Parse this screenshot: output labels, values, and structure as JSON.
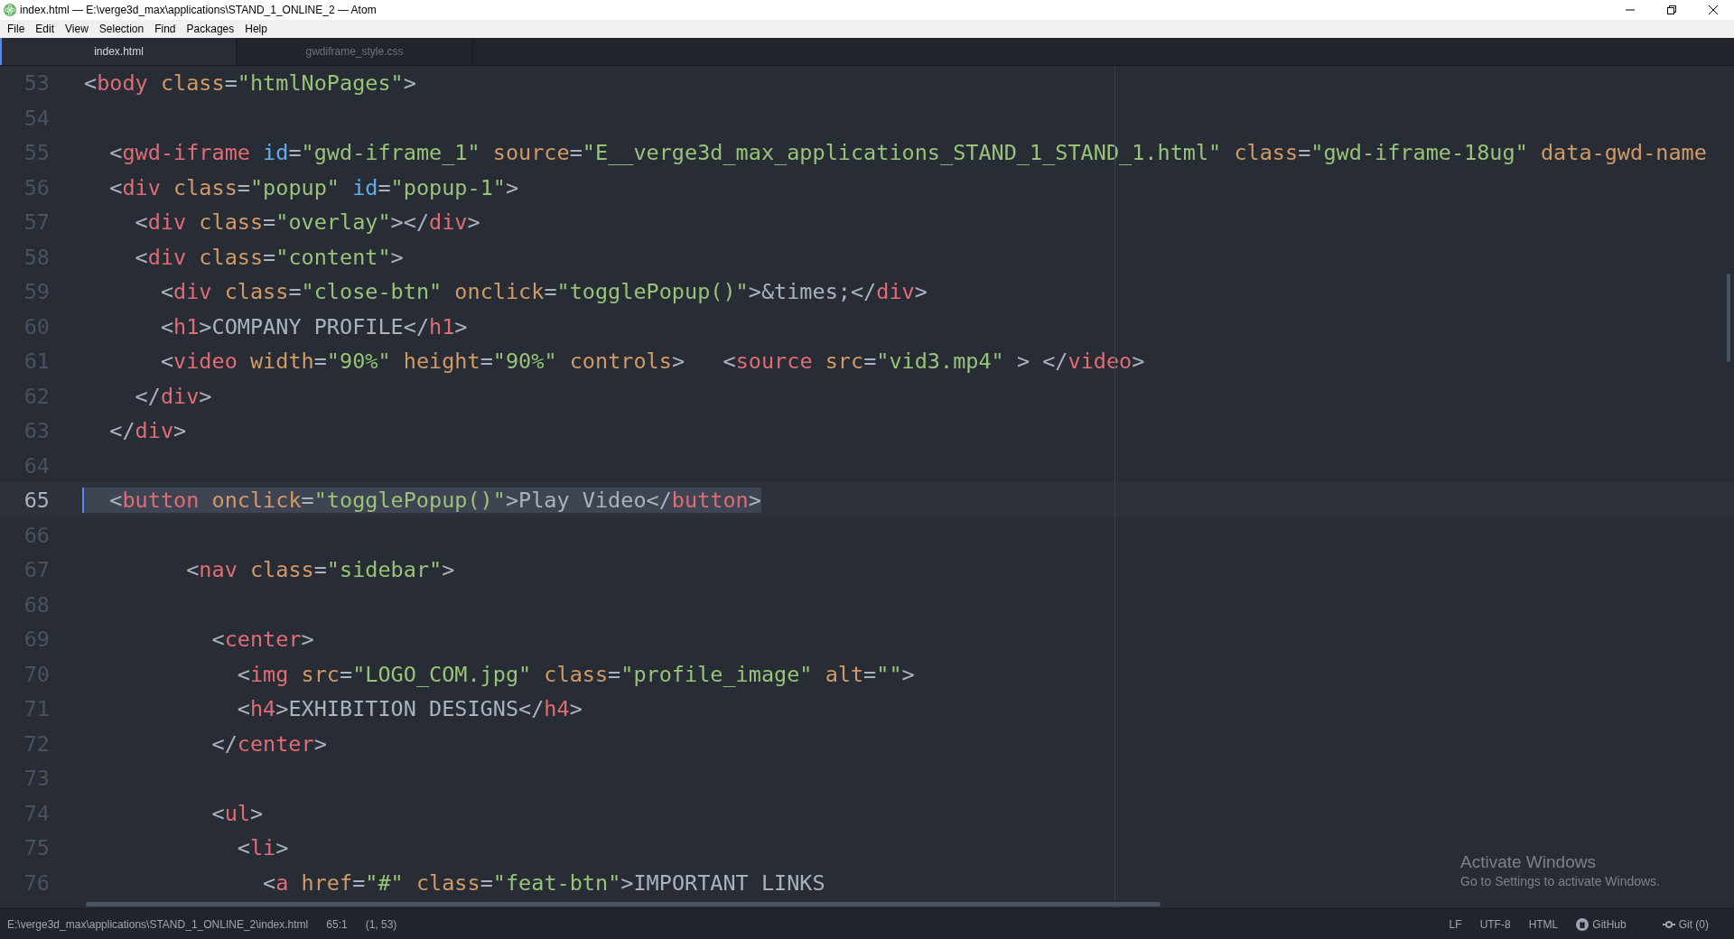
{
  "window": {
    "title": "index.html — E:\\verge3d_max\\applications\\STAND_1_ONLINE_2 — Atom"
  },
  "menu": [
    "File",
    "Edit",
    "View",
    "Selection",
    "Find",
    "Packages",
    "Help"
  ],
  "tabs": [
    {
      "label": "index.html",
      "selected": true
    },
    {
      "label": "gwdiframe_style.css",
      "selected": false
    }
  ],
  "editor": {
    "lines": [
      {
        "number": "53",
        "current": false,
        "tokens": [
          {
            "kind": "punct",
            "text": "<"
          },
          {
            "kind": "tag",
            "text": "body"
          },
          {
            "kind": "attr",
            "text": " class"
          },
          {
            "kind": "punct",
            "text": "="
          },
          {
            "kind": "string",
            "text": "\"htmlNoPages\""
          },
          {
            "kind": "punct",
            "text": ">"
          }
        ]
      },
      {
        "number": "54",
        "current": false
      },
      {
        "number": "55",
        "current": false,
        "tokens": [
          {
            "kind": "punct",
            "text": "  <"
          },
          {
            "kind": "tag",
            "text": "gwd-iframe"
          },
          {
            "kind": "id",
            "text": " id"
          },
          {
            "kind": "punct",
            "text": "="
          },
          {
            "kind": "string",
            "text": "\"gwd-iframe_1\""
          },
          {
            "kind": "attr",
            "text": " source"
          },
          {
            "kind": "punct",
            "text": "="
          },
          {
            "kind": "string",
            "text": "\"E__verge3d_max_applications_STAND_1_STAND_1.html\""
          },
          {
            "kind": "attr",
            "text": " class"
          },
          {
            "kind": "punct",
            "text": "="
          },
          {
            "kind": "string",
            "text": "\"gwd-iframe-18ug\""
          },
          {
            "kind": "attr",
            "text": " data-gwd-name"
          }
        ]
      },
      {
        "number": "56",
        "current": false,
        "tokens": [
          {
            "kind": "punct",
            "text": "  <"
          },
          {
            "kind": "tag",
            "text": "div"
          },
          {
            "kind": "attr",
            "text": " class"
          },
          {
            "kind": "punct",
            "text": "="
          },
          {
            "kind": "string",
            "text": "\"popup\""
          },
          {
            "kind": "id",
            "text": " id"
          },
          {
            "kind": "punct",
            "text": "="
          },
          {
            "kind": "string",
            "text": "\"popup-1\""
          },
          {
            "kind": "punct",
            "text": ">"
          }
        ]
      },
      {
        "number": "57",
        "current": false,
        "tokens": [
          {
            "kind": "punct",
            "text": "    <"
          },
          {
            "kind": "tag",
            "text": "div"
          },
          {
            "kind": "attr",
            "text": " class"
          },
          {
            "kind": "punct",
            "text": "="
          },
          {
            "kind": "string",
            "text": "\"overlay\""
          },
          {
            "kind": "punct",
            "text": "></"
          },
          {
            "kind": "tag",
            "text": "div"
          },
          {
            "kind": "punct",
            "text": ">"
          }
        ]
      },
      {
        "number": "58",
        "current": false,
        "tokens": [
          {
            "kind": "punct",
            "text": "    <"
          },
          {
            "kind": "tag",
            "text": "div"
          },
          {
            "kind": "attr",
            "text": " class"
          },
          {
            "kind": "punct",
            "text": "="
          },
          {
            "kind": "string",
            "text": "\"content\""
          },
          {
            "kind": "punct",
            "text": ">"
          }
        ]
      },
      {
        "number": "59",
        "current": false,
        "tokens": [
          {
            "kind": "punct",
            "text": "      <"
          },
          {
            "kind": "tag",
            "text": "div"
          },
          {
            "kind": "attr",
            "text": " class"
          },
          {
            "kind": "punct",
            "text": "="
          },
          {
            "kind": "string",
            "text": "\"close-btn\""
          },
          {
            "kind": "attr",
            "text": " onclick"
          },
          {
            "kind": "punct",
            "text": "="
          },
          {
            "kind": "string",
            "text": "\"togglePopup()\""
          },
          {
            "kind": "punct",
            "text": ">"
          },
          {
            "kind": "text",
            "text": "&times;"
          },
          {
            "kind": "punct",
            "text": "</"
          },
          {
            "kind": "tag",
            "text": "div"
          },
          {
            "kind": "punct",
            "text": ">"
          }
        ]
      },
      {
        "number": "60",
        "current": false,
        "tokens": [
          {
            "kind": "punct",
            "text": "      <"
          },
          {
            "kind": "tag",
            "text": "h1"
          },
          {
            "kind": "punct",
            "text": ">"
          },
          {
            "kind": "text",
            "text": "COMPANY PROFILE"
          },
          {
            "kind": "punct",
            "text": "</"
          },
          {
            "kind": "tag",
            "text": "h1"
          },
          {
            "kind": "punct",
            "text": ">"
          }
        ]
      },
      {
        "number": "61",
        "current": false,
        "tokens": [
          {
            "kind": "punct",
            "text": "      <"
          },
          {
            "kind": "tag",
            "text": "video"
          },
          {
            "kind": "attr",
            "text": " width"
          },
          {
            "kind": "punct",
            "text": "="
          },
          {
            "kind": "string",
            "text": "\"90%\""
          },
          {
            "kind": "attr",
            "text": " height"
          },
          {
            "kind": "punct",
            "text": "="
          },
          {
            "kind": "string",
            "text": "\"90%\""
          },
          {
            "kind": "attr",
            "text": " controls"
          },
          {
            "kind": "punct",
            "text": ">   <"
          },
          {
            "kind": "tag",
            "text": "source"
          },
          {
            "kind": "attr",
            "text": " src"
          },
          {
            "kind": "punct",
            "text": "="
          },
          {
            "kind": "string",
            "text": "\"vid3.mp4\""
          },
          {
            "kind": "punct",
            "text": " > </"
          },
          {
            "kind": "tag",
            "text": "video"
          },
          {
            "kind": "punct",
            "text": ">"
          }
        ]
      },
      {
        "number": "62",
        "current": false,
        "tokens": [
          {
            "kind": "punct",
            "text": "    </"
          },
          {
            "kind": "tag",
            "text": "div"
          },
          {
            "kind": "punct",
            "text": ">"
          }
        ]
      },
      {
        "number": "63",
        "current": false,
        "tokens": [
          {
            "kind": "punct",
            "text": "  </"
          },
          {
            "kind": "tag",
            "text": "div"
          },
          {
            "kind": "punct",
            "text": ">"
          }
        ]
      },
      {
        "number": "64",
        "current": false
      },
      {
        "number": "65",
        "current": true,
        "tokens": [
          {
            "kind": "punct",
            "text": "  <"
          },
          {
            "kind": "tag",
            "text": "button"
          },
          {
            "kind": "attr",
            "text": " onclick"
          },
          {
            "kind": "punct",
            "text": "="
          },
          {
            "kind": "string",
            "text": "\"togglePopup()\""
          },
          {
            "kind": "punct",
            "text": ">"
          },
          {
            "kind": "text",
            "text": "Play Video"
          },
          {
            "kind": "punct",
            "text": "</"
          },
          {
            "kind": "tag",
            "text": "button"
          },
          {
            "kind": "punct",
            "text": ">"
          }
        ]
      },
      {
        "number": "66",
        "current": false
      },
      {
        "number": "67",
        "current": false,
        "tokens": [
          {
            "kind": "punct",
            "text": "        <"
          },
          {
            "kind": "tag",
            "text": "nav"
          },
          {
            "kind": "attr",
            "text": " class"
          },
          {
            "kind": "punct",
            "text": "="
          },
          {
            "kind": "string",
            "text": "\"sidebar\""
          },
          {
            "kind": "punct",
            "text": ">"
          }
        ]
      },
      {
        "number": "68",
        "current": false
      },
      {
        "number": "69",
        "current": false,
        "tokens": [
          {
            "kind": "punct",
            "text": "          <"
          },
          {
            "kind": "tag",
            "text": "center"
          },
          {
            "kind": "punct",
            "text": ">"
          }
        ]
      },
      {
        "number": "70",
        "current": false,
        "tokens": [
          {
            "kind": "punct",
            "text": "            <"
          },
          {
            "kind": "tag",
            "text": "img"
          },
          {
            "kind": "attr",
            "text": " src"
          },
          {
            "kind": "punct",
            "text": "="
          },
          {
            "kind": "string",
            "text": "\"LOGO_COM.jpg\""
          },
          {
            "kind": "attr",
            "text": " class"
          },
          {
            "kind": "punct",
            "text": "="
          },
          {
            "kind": "string",
            "text": "\"profile_image\""
          },
          {
            "kind": "attr",
            "text": " alt"
          },
          {
            "kind": "punct",
            "text": "="
          },
          {
            "kind": "string",
            "text": "\"\""
          },
          {
            "kind": "punct",
            "text": ">"
          }
        ]
      },
      {
        "number": "71",
        "current": false,
        "tokens": [
          {
            "kind": "punct",
            "text": "            <"
          },
          {
            "kind": "tag",
            "text": "h4"
          },
          {
            "kind": "punct",
            "text": ">"
          },
          {
            "kind": "text",
            "text": "EXHIBITION DESIGNS"
          },
          {
            "kind": "punct",
            "text": "</"
          },
          {
            "kind": "tag",
            "text": "h4"
          },
          {
            "kind": "punct",
            "text": ">"
          }
        ]
      },
      {
        "number": "72",
        "current": false,
        "tokens": [
          {
            "kind": "punct",
            "text": "          </"
          },
          {
            "kind": "tag",
            "text": "center"
          },
          {
            "kind": "punct",
            "text": ">"
          }
        ]
      },
      {
        "number": "73",
        "current": false
      },
      {
        "number": "74",
        "current": false,
        "tokens": [
          {
            "kind": "punct",
            "text": "          <"
          },
          {
            "kind": "tag",
            "text": "ul"
          },
          {
            "kind": "punct",
            "text": ">"
          }
        ]
      },
      {
        "number": "75",
        "current": false,
        "tokens": [
          {
            "kind": "punct",
            "text": "            <"
          },
          {
            "kind": "tag",
            "text": "li"
          },
          {
            "kind": "punct",
            "text": ">"
          }
        ]
      },
      {
        "number": "76",
        "current": false,
        "tokens": [
          {
            "kind": "punct",
            "text": "              <"
          },
          {
            "kind": "tag",
            "text": "a"
          },
          {
            "kind": "attr",
            "text": " href"
          },
          {
            "kind": "punct",
            "text": "="
          },
          {
            "kind": "string",
            "text": "\"#\""
          },
          {
            "kind": "attr",
            "text": " class"
          },
          {
            "kind": "punct",
            "text": "="
          },
          {
            "kind": "string",
            "text": "\"feat-btn\""
          },
          {
            "kind": "punct",
            "text": ">"
          },
          {
            "kind": "text",
            "text": "IMPORTANT LINKS"
          }
        ]
      }
    ]
  },
  "activation_notice": {
    "title": "Activate Windows",
    "subtitle": "Go to Settings to activate Windows."
  },
  "status_bar": {
    "path": "E:\\verge3d_max\\applications\\STAND_1_ONLINE_2\\index.html",
    "cursor": "65:1",
    "selection": "(1, 53)",
    "line_ending": "LF",
    "encoding": "UTF-8",
    "grammar": "HTML",
    "github": "GitHub",
    "git": "Git (0)"
  }
}
